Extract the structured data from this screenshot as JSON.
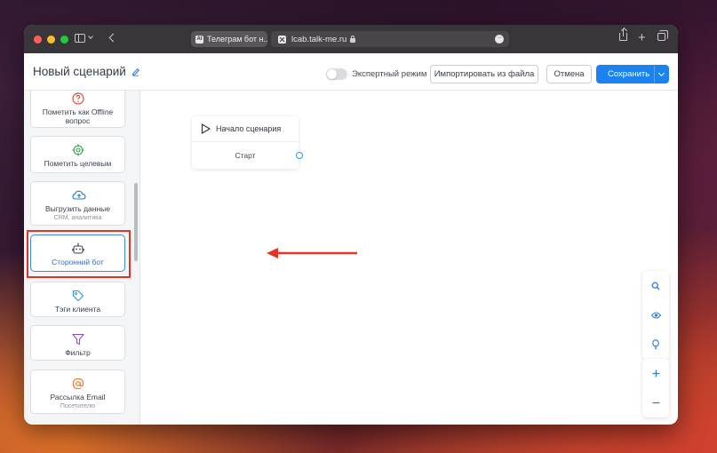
{
  "browser": {
    "tab_title": "Телеграм бот н...",
    "url": "lcab.talk-me.ru"
  },
  "header": {
    "title": "Новый сценарий",
    "expert_mode_label": "Экспертный режим",
    "import_label": "Импортировать из файла",
    "cancel_label": "Отмена",
    "save_label": "Сохранить"
  },
  "palette": {
    "items": [
      {
        "label": "Пометить как Offline вопрос",
        "sub": ""
      },
      {
        "label": "Пометить целевым",
        "sub": ""
      },
      {
        "label": "Выгрузить данные",
        "sub": "CRM, аналитика"
      },
      {
        "label": "Сторонний бот",
        "sub": ""
      },
      {
        "label": "Тэги клиента",
        "sub": ""
      },
      {
        "label": "Фильтр",
        "sub": ""
      },
      {
        "label": "Рассылка Email",
        "sub": "Посетителю"
      }
    ]
  },
  "canvas": {
    "start_node": {
      "title": "Начало сценария",
      "output": "Старт"
    }
  },
  "colors": {
    "accent": "#1b82f0",
    "highlight": "#e53424",
    "active_card_border": "#3b88e6"
  },
  "icons": {
    "palette": [
      "question-circle-icon",
      "target-icon",
      "cloud-upload-icon",
      "robot-icon",
      "tag-icon",
      "funnel-icon",
      "at-sign-icon"
    ],
    "tools": [
      "search-icon",
      "eye-icon",
      "bulb-icon",
      "plus-icon",
      "minus-icon"
    ]
  }
}
